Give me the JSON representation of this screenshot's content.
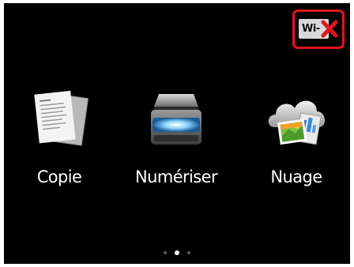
{
  "status_bar": {
    "wifi_label": "Wi-",
    "wifi_state": "disconnected",
    "highlight_color": "#e0141e"
  },
  "menu": {
    "items": [
      {
        "label": "Copie",
        "icon": "copy-documents-icon"
      },
      {
        "label": "Numériser",
        "icon": "scanner-icon"
      },
      {
        "label": "Nuage",
        "icon": "cloud-icon"
      }
    ]
  },
  "pager": {
    "pages": 3,
    "current_page": 2
  }
}
